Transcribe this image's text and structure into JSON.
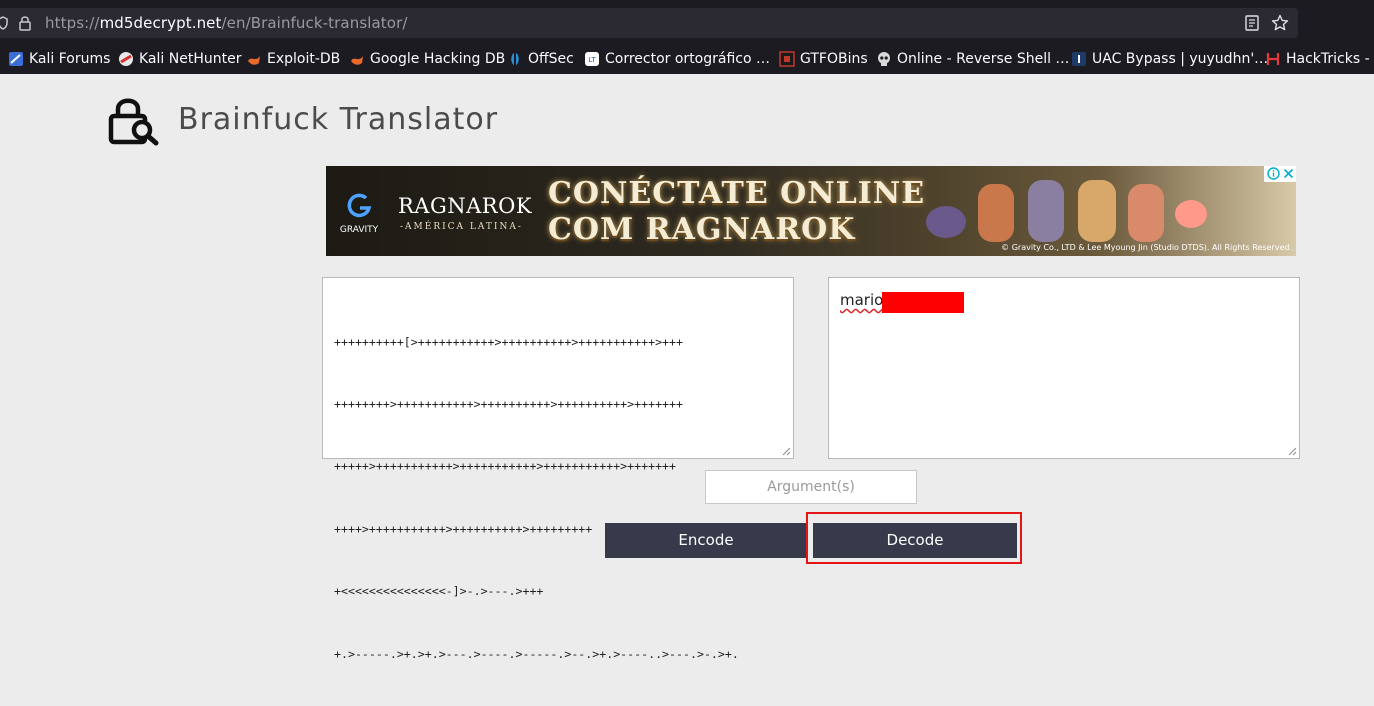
{
  "browser": {
    "url_prefix": "https://",
    "url_host": "md5decrypt.net",
    "url_path": "/en/Brainfuck-translator/",
    "bookmarks": [
      {
        "label": "Kali Forums",
        "icon": "kali-forums-icon"
      },
      {
        "label": "Kali NetHunter",
        "icon": "kali-nethunter-icon"
      },
      {
        "label": "Exploit-DB",
        "icon": "exploit-db-icon"
      },
      {
        "label": "Google Hacking DB",
        "icon": "ghdb-icon"
      },
      {
        "label": "OffSec",
        "icon": "offsec-icon"
      },
      {
        "label": "Corrector ortográfico …",
        "icon": "corrector-icon"
      },
      {
        "label": "GTFOBins",
        "icon": "gtfobins-icon"
      },
      {
        "label": "Online - Reverse Shell …",
        "icon": "skull-icon"
      },
      {
        "label": "UAC Bypass | yuyudhn'…",
        "icon": "uac-icon"
      },
      {
        "label": "HackTricks - H",
        "icon": "hacktricks-icon"
      }
    ]
  },
  "page": {
    "title": "Brainfuck Translator"
  },
  "ad": {
    "brand": "GRAVITY",
    "game": "RAGNAROK",
    "game_sub": "-AMÉRICA LATINA-",
    "headline_1": "CONÉCTATE ONLINE",
    "headline_2": "COM RAGNAROK",
    "copyright": "© Gravity Co., LTD & Lee Myoung Jin (Studio DTDS). All Rights Reserved."
  },
  "translator": {
    "input_code_lines": [
      "++++++++++[>+++++++++++>++++++++++>+++++++++++>+++",
      "++++++++>+++++++++++>++++++++++>++++++++++>+++++++",
      "+++++>+++++++++++>+++++++++++>+++++++++++>+++++++",
      "++++>+++++++++++>++++++++++>+++++++++",
      "+<<<<<<<<<<<<<<<-]>-.>---.>+++",
      "+.>-----.>+.>+.>---.>----.>-----.>--.>+.>----..>---.>-.>+."
    ],
    "output_visible": "mario",
    "argument_placeholder": "Argument(s)",
    "encode_label": "Encode",
    "decode_label": "Decode"
  },
  "colors": {
    "button_bg": "#363a4a",
    "highlight_border": "#e31515",
    "redaction": "#ff0000"
  }
}
